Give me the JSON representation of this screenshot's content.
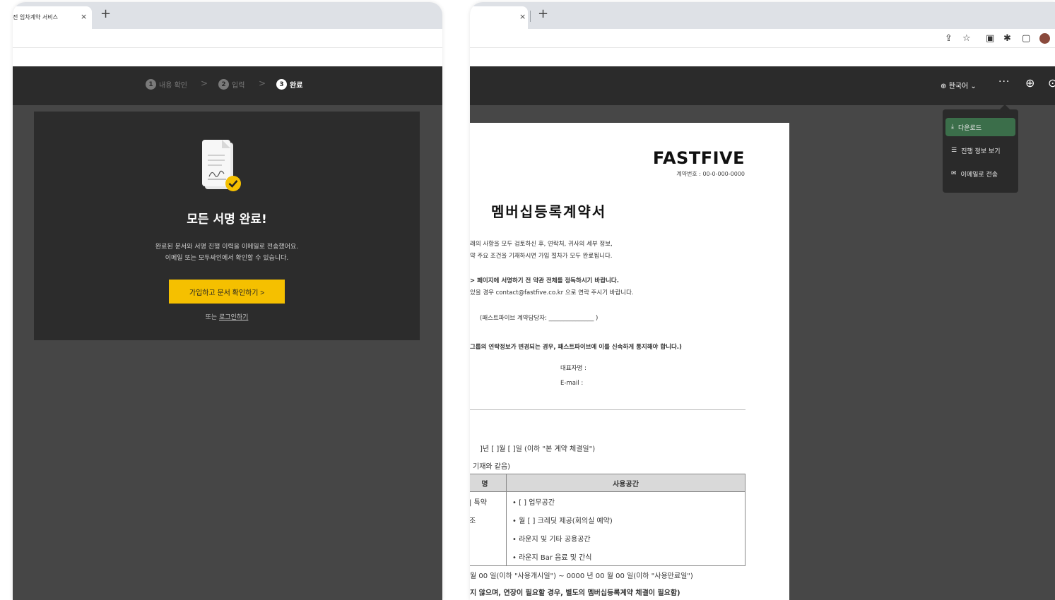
{
  "left_window": {
    "tab_title": "전 임차계약 서비스",
    "tab_close": "×",
    "new_tab": "+",
    "steps": [
      {
        "num": "1",
        "label": "내용 확인"
      },
      {
        "num": "2",
        "label": "입력"
      },
      {
        "num": "3",
        "label": "완료"
      }
    ],
    "step_separator": ">",
    "card": {
      "title": "모든 서명 완료!",
      "desc_line1": "완료된 문서와 서명 진행 이력을 이메일로 전송했어요.",
      "desc_line2": "이메일 또는 모두싸인에서 확인할 수 있습니다.",
      "cta_label": "가입하고 문서 확인하기 >",
      "login_prefix": "또는 ",
      "login_link": "로그인하기"
    }
  },
  "right_window": {
    "tab_close": "×",
    "new_tab": "+",
    "toolbar_icons": [
      "share-icon",
      "star-icon",
      "extension-icon",
      "puzzle-icon",
      "sidebar-icon"
    ],
    "language": "한국어",
    "more_label": "···",
    "menu": {
      "items": [
        {
          "label": "다운로드",
          "icon": "download-icon"
        },
        {
          "label": "진행 정보 보기",
          "icon": "list-icon"
        },
        {
          "label": "이메일로 전송",
          "icon": "mail-icon"
        }
      ]
    },
    "document": {
      "brand": "FASTFIVE",
      "contract_no": "계약번호 : 00-0-000-0000",
      "title": "멤버십등록계약서",
      "lines": [
        "래의 사항을 모두 검토하신 후, 연락처, 귀사의 세부 정보,",
        "약 주요 조건을 기재하시면 가입 절차가 모두 완료됩니다.",
        "> 페이지에 서명하기 전 약관 전체를 정독하시기 바랍니다.",
        "있을 경우 contact@fastfive.co.kr 으로 연락 주시기 바랍니다.",
        "(패스트파이브 계약담당자: _______________ )",
        "그룹의 연락정보가 변경되는 경우, 패스트파이브에 이를 신속하게 통지해야 합니다.)",
        "대표자명 :",
        "E-mail :",
        "]년 [   ]월 [   ]일 (이하 \"본 계약 체결일\")",
        "기재와 같음)",
        "월 00 일(이하 \"사용개시일\") ~ 0000 년 00 월 00 일(이하 \"사용만료일\")",
        "지 않으며, 연장이 필요할 경우, 별도의 멤버십등록계약 체결이 필요함)"
      ],
      "table": {
        "headers": [
          "명",
          "사용공간"
        ],
        "rows": [
          [
            "| 특약",
            "• [    ] 업무공간"
          ],
          [
            "조",
            "• 월 [  ] 크레딧 제공(회의실 예약)"
          ],
          [
            "",
            "• 라운지 및 기타 공용공간"
          ],
          [
            "",
            "• 라운지 Bar 음료 및 간식"
          ]
        ]
      }
    }
  }
}
